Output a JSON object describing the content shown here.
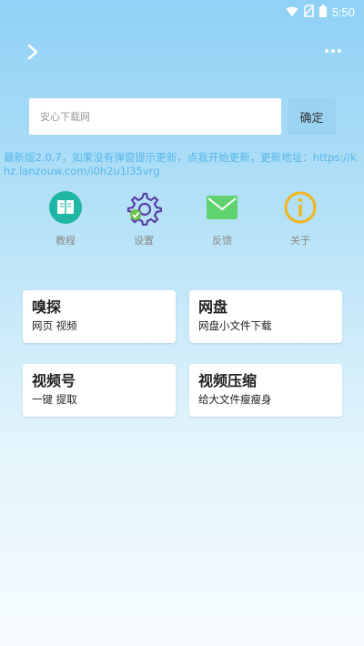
{
  "status_bar": {
    "time": "5:50",
    "icons": [
      "wifi-icon",
      "no-sim-icon",
      "battery-icon"
    ]
  },
  "topbar": {
    "back_icon": "chevron-right-icon",
    "more_icon": "more-icon"
  },
  "search": {
    "placeholder": "安心下载网",
    "value": "",
    "confirm_label": "确定"
  },
  "notice": "最新版2.0.7，如果没有弹窗提示更新，点我开始更新，更新地址：https://khz.lanzouw.com/i0h2u1i35vrg",
  "shortcuts": [
    {
      "label": "教程",
      "icon": "book-icon",
      "color": "#1fb7a3"
    },
    {
      "label": "设置",
      "icon": "gear-icon",
      "color": "#5b3fa8"
    },
    {
      "label": "反馈",
      "icon": "mail-icon",
      "color": "#5fd36e"
    },
    {
      "label": "关于",
      "icon": "info-icon",
      "color": "#f3b51b"
    }
  ],
  "cards": [
    {
      "title": "嗅探",
      "subtitle": "网页 视频"
    },
    {
      "title": "网盘",
      "subtitle": "网盘小文件下载"
    },
    {
      "title": "视频号",
      "subtitle": "一键 提取"
    },
    {
      "title": "视频压缩",
      "subtitle": "给大文件瘦瘦身"
    }
  ],
  "colors": {
    "accent": "#56b7ea",
    "button_bg": "#9ad4f2"
  }
}
